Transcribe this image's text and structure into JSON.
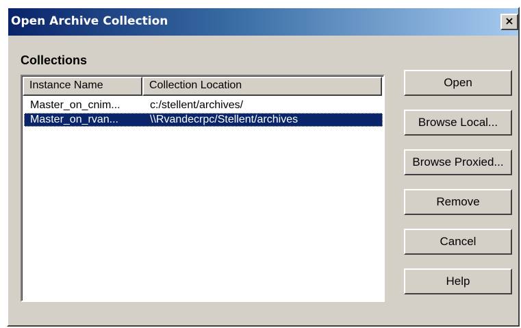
{
  "window": {
    "title": "Open Archive Collection",
    "close_glyph": "×"
  },
  "collections": {
    "label": "Collections",
    "columns": [
      "Instance Name",
      "Collection Location"
    ],
    "rows": [
      {
        "instance": "Master_on_cnim...",
        "location": "c:/stellent/archives/",
        "selected": false
      },
      {
        "instance": "Master_on_rvan...",
        "location": "\\\\Rvandecrpc/Stellent/archives",
        "selected": true
      }
    ]
  },
  "buttons": {
    "open": "Open",
    "browse_local": "Browse Local...",
    "browse_proxied": "Browse Proxied...",
    "remove": "Remove",
    "cancel": "Cancel",
    "help": "Help"
  },
  "colors": {
    "selection": "#0a246a",
    "face": "#d4d0c8",
    "title_start": "#0a246a",
    "title_end": "#a6caf0"
  }
}
